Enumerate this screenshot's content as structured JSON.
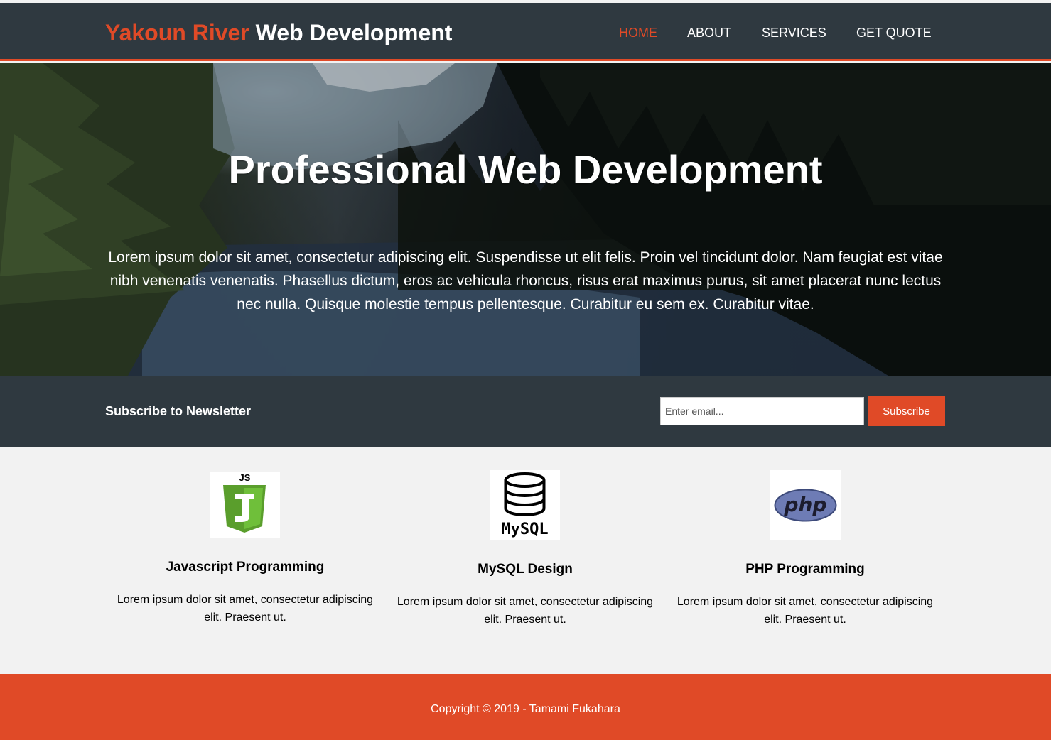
{
  "header": {
    "brand_highlight": "Yakoun River",
    "brand_rest": "Web Development",
    "nav": [
      {
        "label": "HOME",
        "active": true
      },
      {
        "label": "ABOUT",
        "active": false
      },
      {
        "label": "SERVICES",
        "active": false
      },
      {
        "label": "GET QUOTE",
        "active": false
      }
    ]
  },
  "hero": {
    "title": "Professional Web Development",
    "text": "Lorem ipsum dolor sit amet, consectetur adipiscing elit. Suspendisse ut elit felis. Proin vel tincidunt dolor. Nam feugiat est vitae nibh venenatis venenatis. Phasellus dictum, eros ac vehicula rhoncus, risus erat maximus purus, sit amet placerat nunc lectus nec nulla. Quisque molestie tempus pellentesque. Curabitur eu sem ex. Curabitur vitae."
  },
  "newsletter": {
    "title": "Subscribe to Newsletter",
    "placeholder": "Enter email...",
    "button": "Subscribe"
  },
  "services": [
    {
      "icon": "js-icon",
      "logo_text": "JS",
      "title": "Javascript Programming",
      "text": "Lorem ipsum dolor sit amet, consectetur adipiscing elit. Praesent ut."
    },
    {
      "icon": "mysql-icon",
      "logo_text": "MySQL",
      "title": "MySQL Design",
      "text": "Lorem ipsum dolor sit amet, consectetur adipiscing elit. Praesent ut."
    },
    {
      "icon": "php-icon",
      "logo_text": "php",
      "title": "PHP Programming",
      "text": "Lorem ipsum dolor sit amet, consectetur adipiscing elit. Praesent ut."
    }
  ],
  "footer": {
    "copyright": "Copyright © 2019 - Tamami Fukahara"
  },
  "colors": {
    "accent": "#e04a27",
    "dark": "#2f3940",
    "light_bg": "#f2f2f2",
    "js_green": "#5a9e2c",
    "php_blue": "#6e7cb5"
  }
}
